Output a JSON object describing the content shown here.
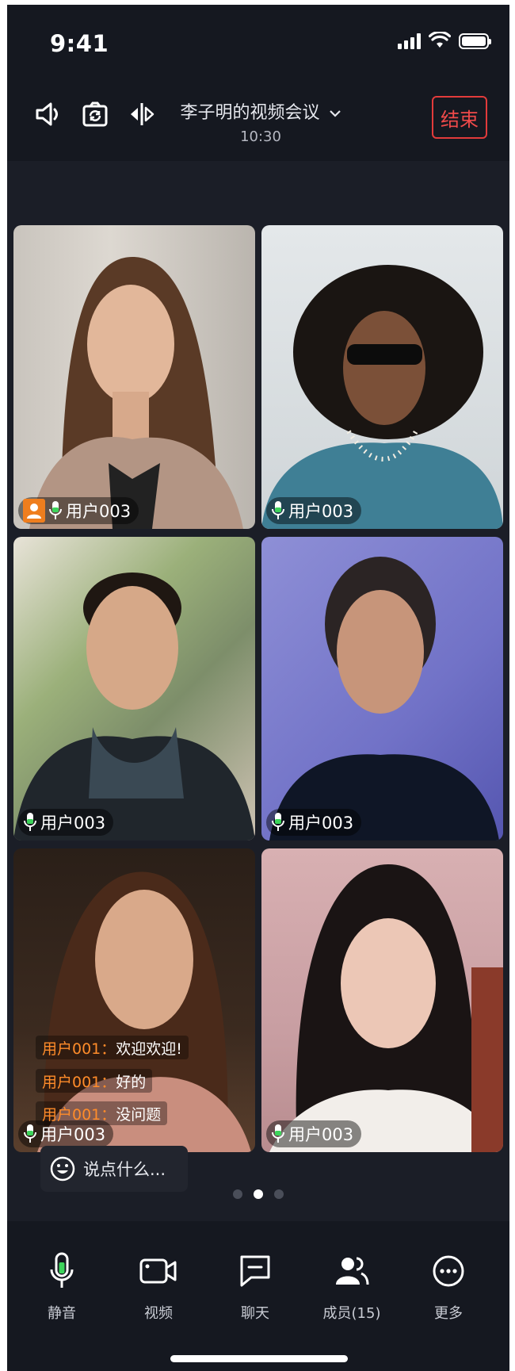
{
  "status_bar": {
    "time": "9:41"
  },
  "header": {
    "meeting_title": "李子明的视频会议",
    "meeting_time": "10:30",
    "end_button": "结束"
  },
  "tiles": [
    {
      "name": "用户003",
      "is_host": true
    },
    {
      "name": "用户003",
      "is_host": false
    },
    {
      "name": "用户003",
      "is_host": false
    },
    {
      "name": "用户003",
      "is_host": false
    },
    {
      "name": "用户003",
      "is_host": false
    },
    {
      "name": "用户003",
      "is_host": false
    }
  ],
  "chat": {
    "messages": [
      {
        "sender": "用户001：",
        "text": "欢迎欢迎!"
      },
      {
        "sender": "用户001：",
        "text": "好的"
      },
      {
        "sender": "用户001：",
        "text": "没问题"
      }
    ],
    "input_placeholder": "说点什么..."
  },
  "pagination": {
    "pages": 3,
    "current": 2
  },
  "bottom_tabs": [
    {
      "label": "静音",
      "icon": "microphone-icon"
    },
    {
      "label": "视频",
      "icon": "video-camera-icon"
    },
    {
      "label": "聊天",
      "icon": "chat-icon"
    },
    {
      "label": "成员(15)",
      "icon": "members-icon"
    },
    {
      "label": "更多",
      "icon": "more-icon"
    }
  ],
  "colors": {
    "background": "#1b1e27",
    "bar": "#151820",
    "end_red": "#e23b3b",
    "host_orange": "#ef7e1e",
    "mic_green": "#3dd45b",
    "chat_sender": "#ff8c2a"
  }
}
